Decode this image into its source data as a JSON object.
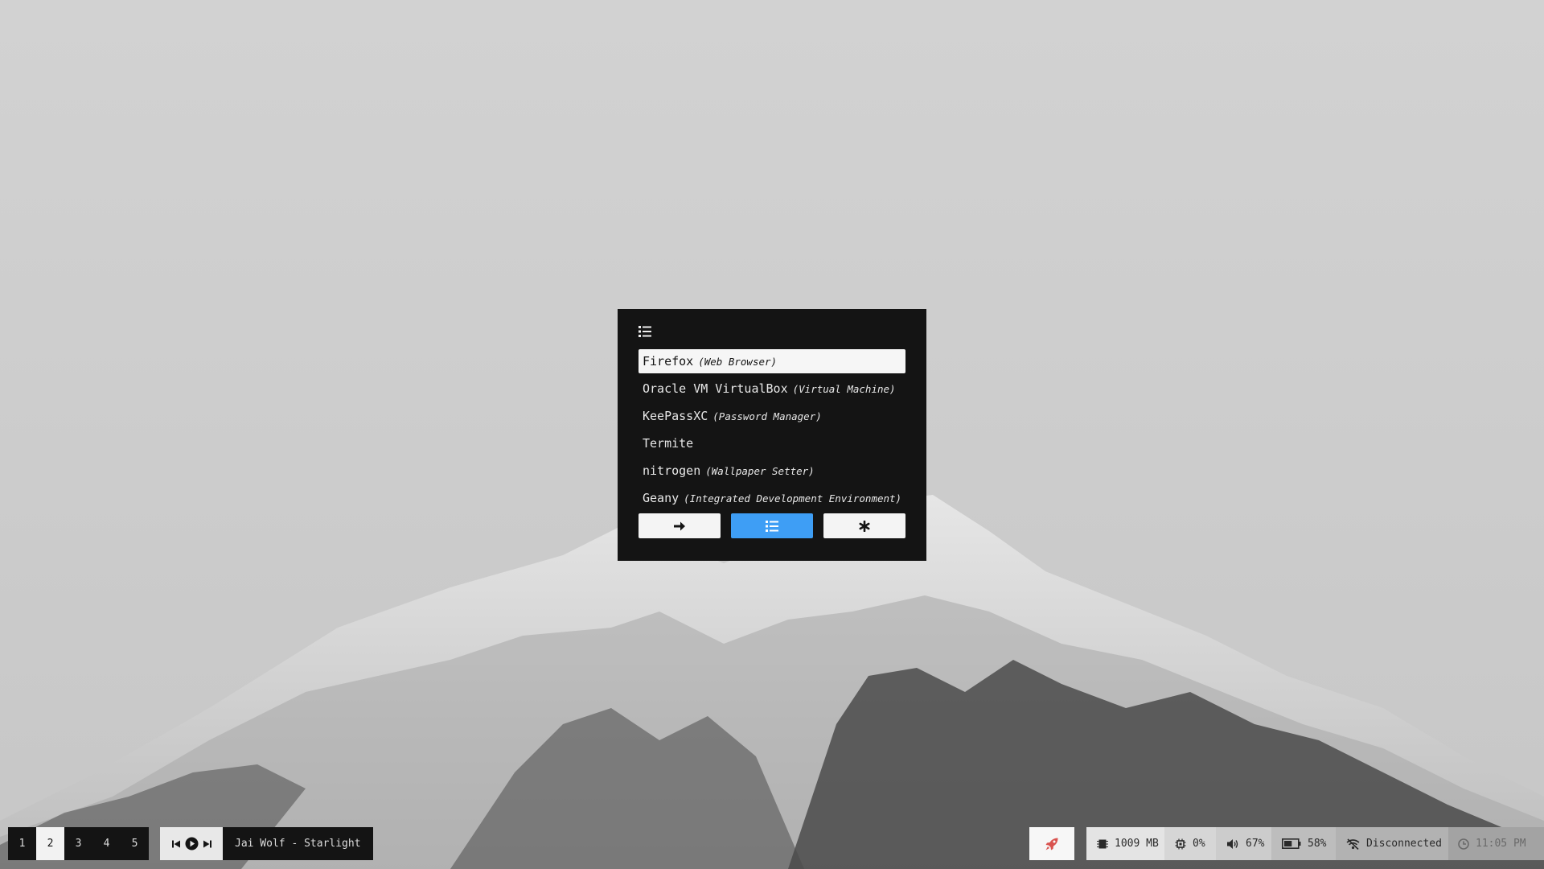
{
  "launcher": {
    "entries": [
      {
        "name": "Firefox",
        "desc": "(Web Browser)",
        "selected": true
      },
      {
        "name": "Oracle VM VirtualBox",
        "desc": "(Virtual Machine)"
      },
      {
        "name": "KeePassXC",
        "desc": "(Password Manager)"
      },
      {
        "name": "Termite",
        "desc": ""
      },
      {
        "name": "nitrogen",
        "desc": "(Wallpaper Setter)"
      },
      {
        "name": "Geany",
        "desc": "(Integrated Development Environment)"
      }
    ],
    "modes": [
      {
        "icon": "arrow-right-icon",
        "active": false
      },
      {
        "icon": "list-icon",
        "active": true
      },
      {
        "icon": "asterisk-icon",
        "active": false
      }
    ]
  },
  "bar": {
    "workspaces": [
      {
        "label": "1",
        "active": false
      },
      {
        "label": "2",
        "active": true
      },
      {
        "label": "3",
        "active": false
      },
      {
        "label": "4",
        "active": false
      },
      {
        "label": "5",
        "active": false
      }
    ],
    "media": {
      "title": "Jai Wolf - Starlight",
      "icons": [
        "skip-back-icon",
        "play-icon",
        "skip-forward-icon"
      ]
    },
    "launcher_icon": "rocket-icon",
    "memory": {
      "icon": "memory-chip-icon",
      "value": "1009 MB"
    },
    "cpu": {
      "icon": "cpu-icon",
      "value": "0%"
    },
    "volume": {
      "icon": "volume-icon",
      "value": "67%"
    },
    "battery": {
      "icon": "battery-icon",
      "value": "58%",
      "level": 0.58
    },
    "network": {
      "icon": "wifi-off-icon",
      "value": "Disconnected"
    },
    "clock": {
      "icon": "clock-icon",
      "value": "11:05 PM"
    }
  },
  "colors": {
    "accent": "#3e9ef5",
    "dark": "#141414",
    "rocket": "#d9534f"
  }
}
